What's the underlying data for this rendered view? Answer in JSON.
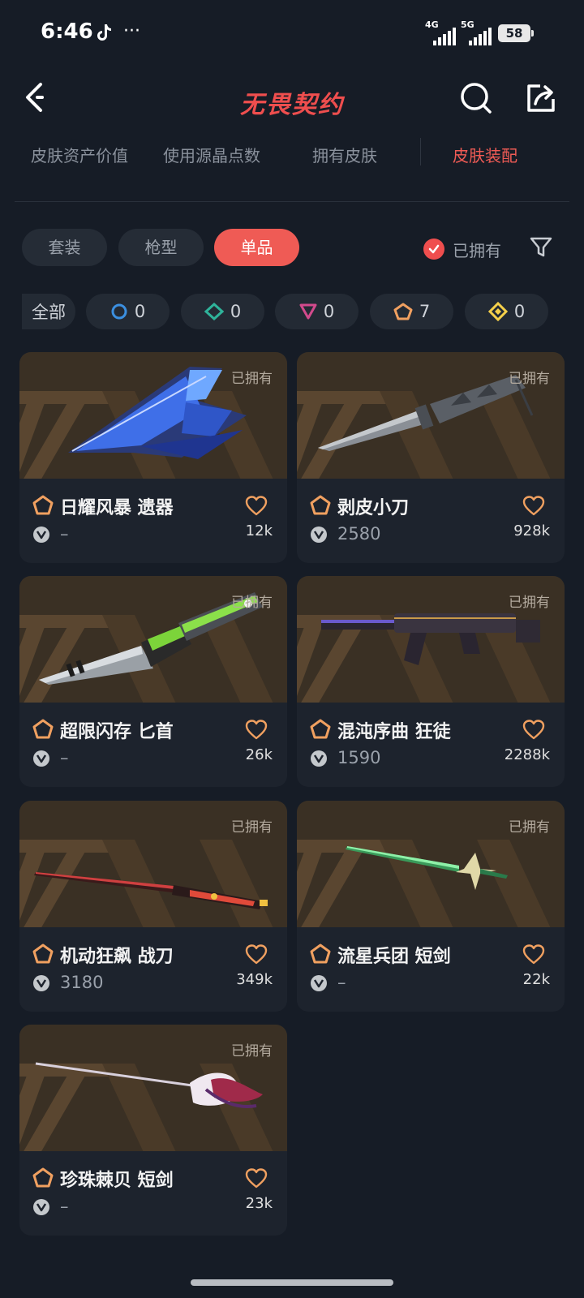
{
  "status_bar": {
    "time": "6:46",
    "dots": "···",
    "sig1": "4G",
    "sig2": "5G",
    "battery": "58"
  },
  "header": {
    "title": "无畏契约"
  },
  "top_tabs": [
    {
      "label": "皮肤资产价值"
    },
    {
      "label": "使用源晶点数"
    },
    {
      "label": "拥有皮肤"
    },
    {
      "label": "皮肤装配"
    }
  ],
  "filter_chips": [
    {
      "label": "套装"
    },
    {
      "label": "枪型"
    },
    {
      "label": "单品"
    }
  ],
  "owned_toggle": {
    "label": "已拥有",
    "checked": true
  },
  "tiers": [
    {
      "label": "全部"
    },
    {
      "count": "0",
      "color": "#3b8fe0"
    },
    {
      "count": "0",
      "color": "#2fb39a"
    },
    {
      "count": "0",
      "color": "#d24a8c"
    },
    {
      "count": "7",
      "color": "#f0a060"
    },
    {
      "count": "0",
      "color": "#f5d04a"
    }
  ],
  "cards": [
    {
      "owned": "已拥有",
      "name": "日耀风暴 遗器",
      "price": "–",
      "likes": "12k"
    },
    {
      "owned": "已拥有",
      "name": "剥皮小刀",
      "price": "2580",
      "likes": "928k"
    },
    {
      "owned": "已拥有",
      "name": "超限闪存 匕首",
      "price": "–",
      "likes": "26k"
    },
    {
      "owned": "已拥有",
      "name": "混沌序曲 狂徒",
      "price": "1590",
      "likes": "2288k"
    },
    {
      "owned": "已拥有",
      "name": "机动狂飙 战刀",
      "price": "3180",
      "likes": "349k"
    },
    {
      "owned": "已拥有",
      "name": "流星兵团 短剑",
      "price": "–",
      "likes": "22k"
    },
    {
      "owned": "已拥有",
      "name": "珍珠棘贝 短剑",
      "price": "–",
      "likes": "23k"
    }
  ]
}
